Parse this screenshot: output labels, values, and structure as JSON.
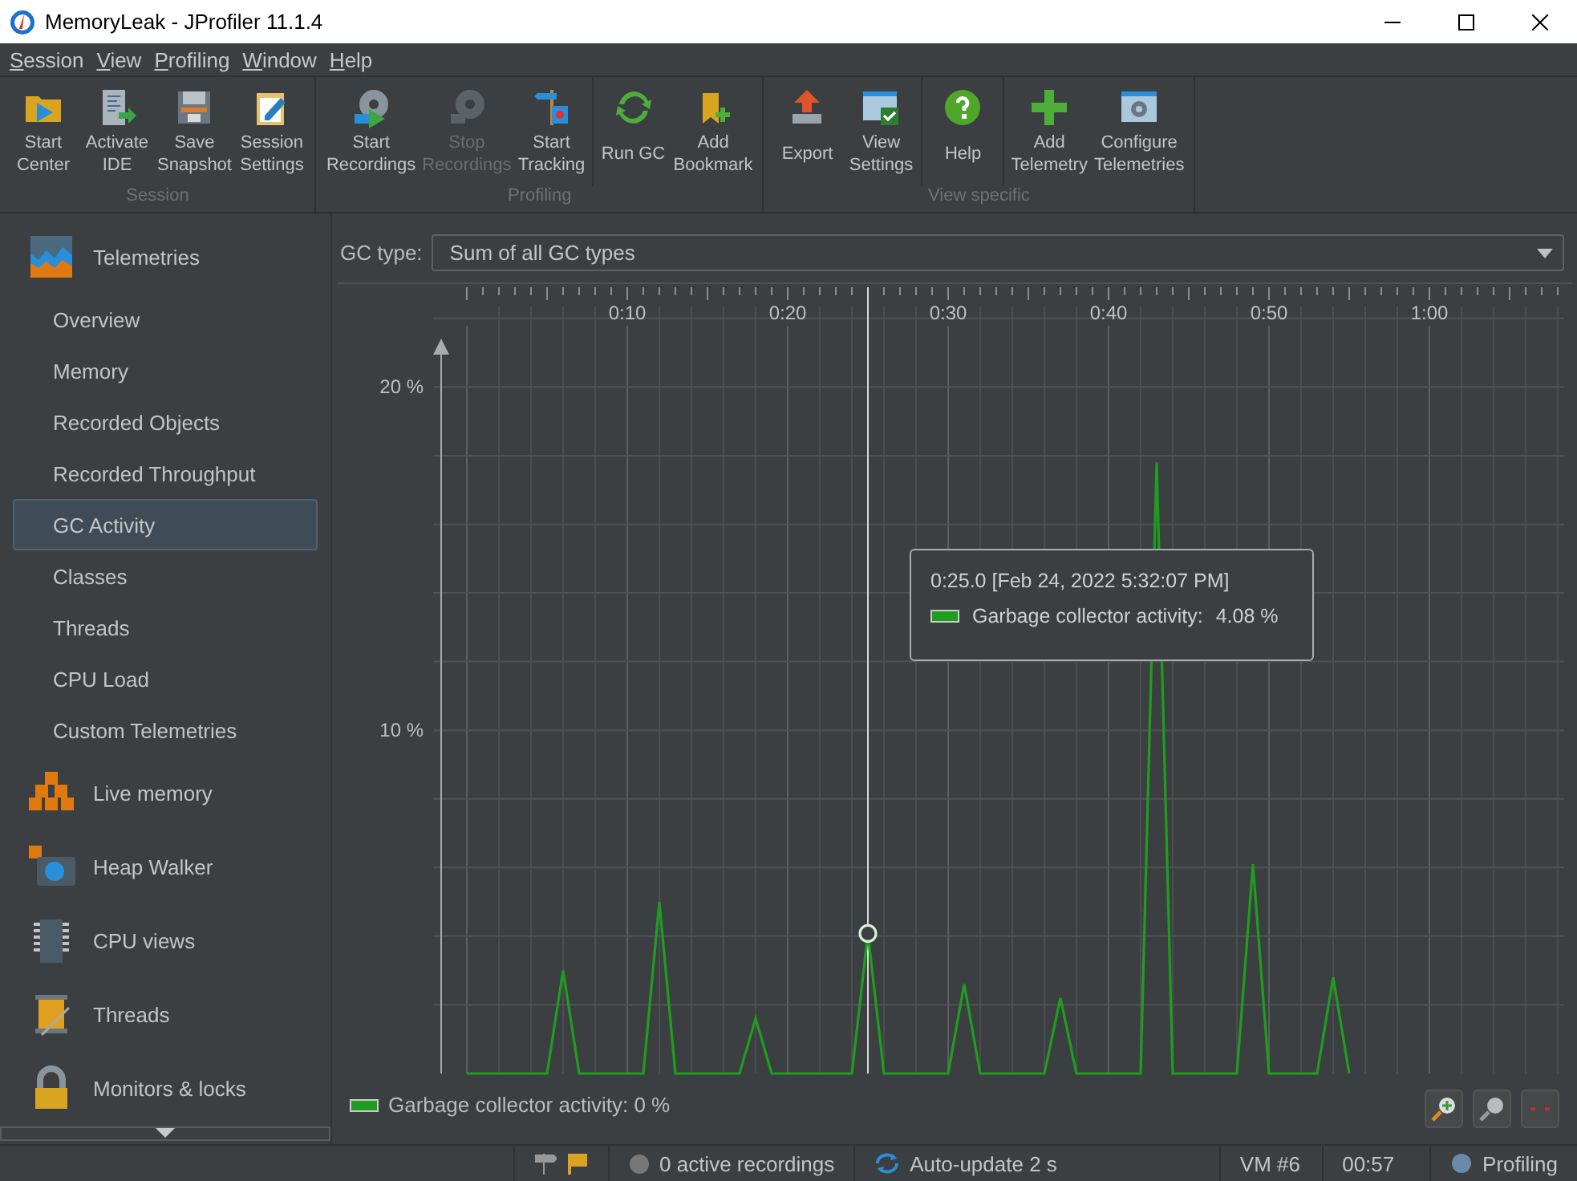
{
  "window": {
    "title": "MemoryLeak - JProfiler 11.1.4"
  },
  "menu": [
    "Session",
    "View",
    "Profiling",
    "Window",
    "Help"
  ],
  "toolbar": {
    "groups": [
      {
        "label": "Session",
        "clusters": [
          [
            {
              "label": "Start Center",
              "disabled": false
            },
            {
              "label": "Activate IDE",
              "disabled": false
            },
            {
              "label": "Save Snapshot",
              "disabled": false
            },
            {
              "label": "Session Settings",
              "disabled": false
            }
          ]
        ]
      },
      {
        "label": "Profiling",
        "clusters": [
          [
            {
              "label": "Start Recordings",
              "disabled": false
            },
            {
              "label": "Stop Recordings",
              "disabled": true
            },
            {
              "label": "Start Tracking",
              "disabled": false
            }
          ],
          [
            {
              "label": "Run GC",
              "disabled": false
            },
            {
              "label": "Add Bookmark",
              "disabled": false
            }
          ]
        ]
      },
      {
        "label": "View specific",
        "clusters": [
          [
            {
              "label": "Export",
              "disabled": false
            },
            {
              "label": "View Settings",
              "disabled": false
            }
          ],
          [
            {
              "label": "Help",
              "disabled": false
            }
          ],
          [
            {
              "label": "Add Telemetry",
              "disabled": false
            },
            {
              "label": "Configure Telemetries",
              "disabled": false
            }
          ]
        ]
      }
    ]
  },
  "sidebar": {
    "sections": [
      {
        "label": "Telemetries",
        "children": [
          {
            "label": "Overview",
            "selected": false
          },
          {
            "label": "Memory",
            "selected": false
          },
          {
            "label": "Recorded Objects",
            "selected": false
          },
          {
            "label": "Recorded Throughput",
            "selected": false
          },
          {
            "label": "GC Activity",
            "selected": true
          },
          {
            "label": "Classes",
            "selected": false
          },
          {
            "label": "Threads",
            "selected": false
          },
          {
            "label": "CPU Load",
            "selected": false
          },
          {
            "label": "Custom Telemetries",
            "selected": false
          }
        ]
      },
      {
        "label": "Live memory"
      },
      {
        "label": "Heap Walker"
      },
      {
        "label": "CPU views"
      },
      {
        "label": "Threads"
      },
      {
        "label": "Monitors & locks"
      }
    ]
  },
  "main": {
    "gc_type": {
      "label": "GC type:",
      "value": "Sum of all GC types"
    },
    "chart_data": {
      "type": "line",
      "x": [
        0,
        1,
        2,
        3,
        4,
        5,
        6,
        7,
        8,
        9,
        10,
        11,
        12,
        13,
        14,
        15,
        16,
        17,
        18,
        19,
        20,
        21,
        22,
        23,
        24,
        25,
        26,
        27,
        28,
        29,
        30,
        31,
        32,
        33,
        34,
        35,
        36,
        37,
        38,
        39,
        40,
        41,
        42,
        43,
        44,
        45,
        46,
        47,
        48,
        49,
        50,
        51,
        52,
        53,
        54,
        55
      ],
      "series": [
        {
          "name": "Garbage collector activity:",
          "color": "#1e9e1e",
          "values": [
            0,
            0,
            0,
            0,
            0,
            0,
            3.0,
            0,
            0,
            0,
            0,
            0,
            5.0,
            0,
            0,
            0,
            0,
            0,
            1.6,
            0,
            0,
            0,
            0,
            0,
            0,
            4.08,
            0,
            0,
            0,
            0,
            0,
            2.6,
            0,
            0,
            0,
            0,
            0,
            2.2,
            0,
            0,
            0,
            0,
            0,
            17.8,
            0,
            0,
            0,
            0,
            0,
            6.1,
            0,
            0,
            0,
            0,
            2.8,
            0
          ]
        }
      ],
      "xlim": [
        -8.1,
        68.4
      ],
      "ylim": [
        0,
        23
      ],
      "grid": true,
      "xticks": [
        {
          "value": 10,
          "label": "0:10"
        },
        {
          "value": 20,
          "label": "0:20"
        },
        {
          "value": 30,
          "label": "0:30"
        },
        {
          "value": 40,
          "label": "0:40"
        },
        {
          "value": 50,
          "label": "0:50"
        },
        {
          "value": 60,
          "label": "1:00"
        }
      ],
      "yticks": [
        {
          "value": 10,
          "label": "10 %"
        },
        {
          "value": 20,
          "label": "20 %"
        }
      ],
      "ref_lines": [
        {
          "axis": "x",
          "value": 25,
          "color": "#d8d8d8"
        }
      ]
    },
    "tooltip": {
      "time": "0:25.0 [Feb 24, 2022 5:32:07 PM]",
      "label": "Garbage collector activity:",
      "value": "4.08 %"
    },
    "legend": {
      "value": "0 %"
    }
  },
  "status_bar": {
    "recordings": "0 active recordings",
    "auto_update": "Auto-update 2 s",
    "vm": "VM #6",
    "elapsed": "00:57",
    "mode": "Profiling"
  }
}
